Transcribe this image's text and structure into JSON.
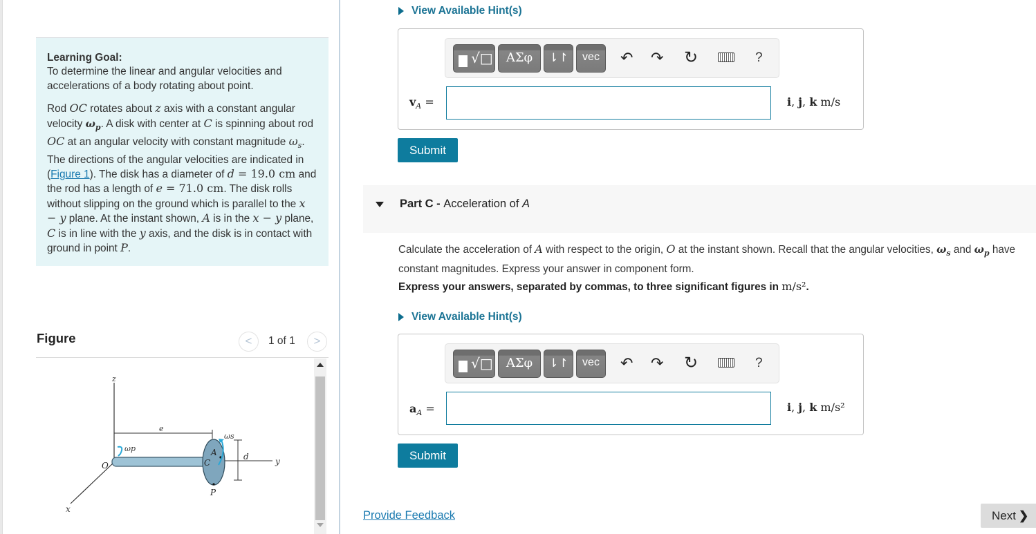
{
  "left": {
    "learning_goal": {
      "title": "Learning Goal:",
      "goal_text": "To determine the linear and angular velocities and accelerations of a body rotating about point.",
      "problem": {
        "p1": "Rod ",
        "OC": "OC",
        "p2": " rotates about ",
        "z": "z",
        "p3": " axis with a constant angular velocity ",
        "omega_p": "ω",
        "omega_p_sub": "p",
        "p4": ". A disk with center at ",
        "C": "C",
        "p5": " is spinning about rod ",
        "OC2": "OC",
        "p6": " at an angular velocity with constant magnitude ",
        "omega_s": "ω",
        "omega_s_sub": "s",
        "p7": ". The directions of the angular velocities are indicated in (",
        "figure_link": "Figure 1",
        "p8": "). The disk has a diameter of ",
        "d_var": "d",
        "d_eq": " = 19.0 cm",
        "p9": " and the rod has a length of ",
        "e_var": "e",
        "e_eq": " = 71.0 cm",
        "p10": ". The disk rolls without slipping on the ground which is parallel to the ",
        "xy1": "x − y",
        "p11": " plane. At the instant shown, ",
        "A": "A",
        "p12": " is in the ",
        "xy2": "x − y",
        "p13": " plane, ",
        "C2": "C",
        "p14": " is in line with the ",
        "y": "y",
        "p15": " axis, and the disk is in contact with ground in point ",
        "P": "P",
        "p16": "."
      }
    },
    "figure": {
      "title": "Figure",
      "pager": "1 of 1",
      "prev_icon": "chevron-left-icon",
      "next_icon": "chevron-right-icon",
      "labels": {
        "z": "z",
        "x": "x",
        "y": "y",
        "O": "O",
        "C": "C",
        "A": "A",
        "P": "P",
        "e": "e",
        "d": "d",
        "omega_p": "ωp",
        "omega_s": "ωs"
      }
    }
  },
  "right": {
    "hint_label": "View Available Hint(s)",
    "toolbar": {
      "templates_icon": "fraction-root-icon",
      "greek_label": "ΑΣφ",
      "arrows_label": "⇂↾",
      "vec_label": "vec",
      "undo_icon": "undo-icon",
      "redo_icon": "redo-icon",
      "reset_icon": "reset-icon",
      "keyboard_icon": "keyboard-icon",
      "help_label": "?"
    },
    "part_b": {
      "var": "v",
      "sub": "A",
      "equals": " =",
      "value": "",
      "units_i": "i",
      "units_j": "j",
      "units_k": "k",
      "units_tail": " m/s",
      "submit_label": "Submit"
    },
    "part_c": {
      "part_label": "Part C - ",
      "part_title": "Acceleration of ",
      "part_title_var": "A",
      "question": {
        "q1": "Calculate the acceleration of ",
        "A": "A",
        "q2": " with respect to the origin, ",
        "O": "O",
        "q3": " at the instant shown. Recall that the angular velocities, ",
        "ws": "ω",
        "ws_sub": "s",
        "q4": " and ",
        "wp": "ω",
        "wp_sub": "p",
        "q5": " have constant magnitudes. Express your answer in component form."
      },
      "instruction": "Express your answers, separated by commas, to three significant figures in ",
      "instruction_units": "m/s²",
      "instruction_end": ".",
      "hint_label": "View Available Hint(s)",
      "var": "a",
      "sub": "A",
      "equals": " =",
      "value": "",
      "units_i": "i",
      "units_j": "j",
      "units_k": "k",
      "units_tail": " m/s²",
      "submit_label": "Submit"
    },
    "feedback_label": "Provide Feedback",
    "next_label": "Next",
    "next_icon": "❯"
  },
  "colors": {
    "accent": "#0e7c9e",
    "link": "#1a7ab0",
    "goal_bg": "#e5f5f7",
    "part_header_bg": "#f7f7f7"
  }
}
